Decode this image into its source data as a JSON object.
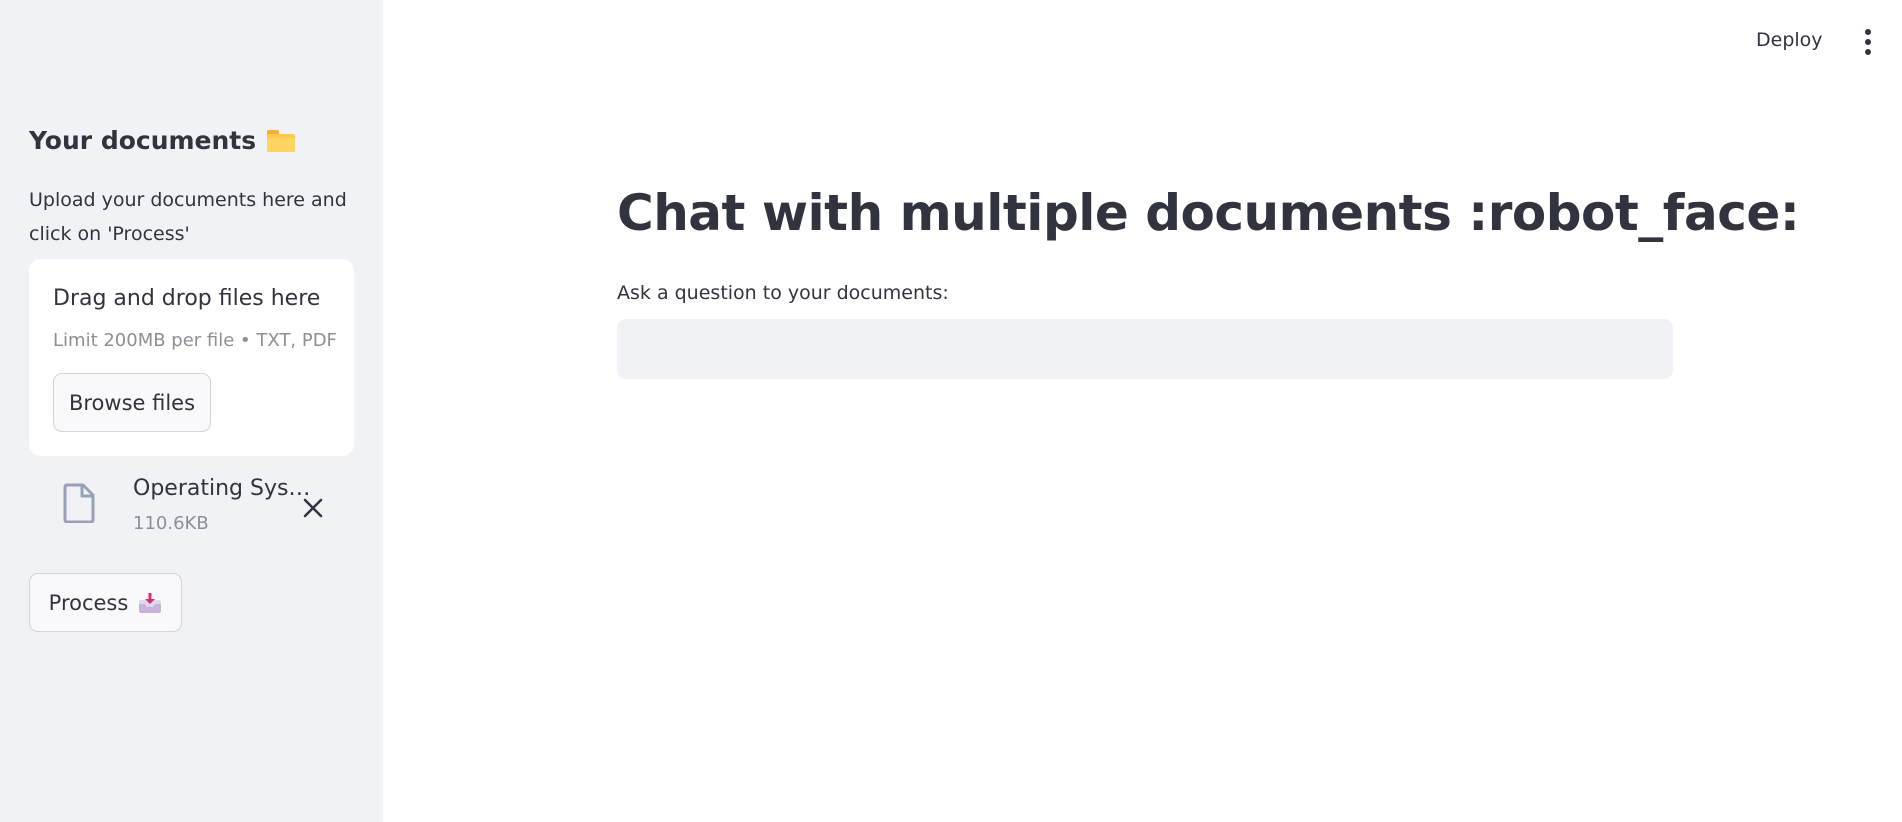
{
  "header": {
    "deploy_label": "Deploy",
    "menu_icon": "more-vertical-icon"
  },
  "sidebar": {
    "title": "Your documents",
    "title_icon": "folder-icon",
    "description": "Upload your documents here and click on 'Process'",
    "uploader": {
      "drop_text": "Drag and drop files here",
      "limit_text": "Limit 200MB per file • TXT, PDF",
      "browse_label": "Browse files"
    },
    "files": [
      {
        "name": "Operating Sys…",
        "size": "110.6KB",
        "icon": "file-icon"
      }
    ],
    "process_label": "Process",
    "process_icon": "inbox-tray-icon"
  },
  "main": {
    "title": "Chat with multiple documents :robot_face:",
    "question_label": "Ask a question to your documents:",
    "question_value": "",
    "question_placeholder": ""
  },
  "colors": {
    "sidebar_bg": "#f0f2f6",
    "text": "#31333f",
    "muted_text": "#8c8f98",
    "input_bg": "#f0f2f6"
  }
}
